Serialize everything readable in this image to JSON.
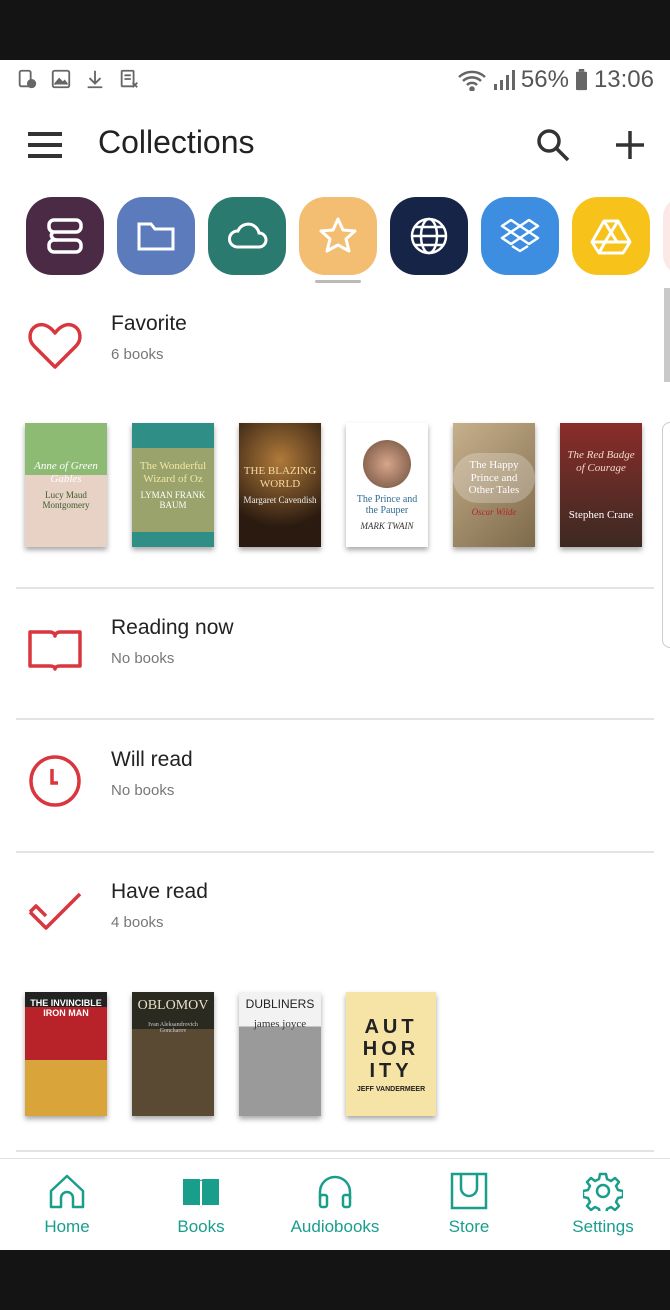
{
  "status_bar": {
    "left_icons": [
      "screenshot-icon",
      "image-icon",
      "download-icon",
      "app-notification-icon"
    ],
    "battery": "56%",
    "time": "13:06"
  },
  "app_bar": {
    "title": "Collections"
  },
  "sources": [
    {
      "icon": "stack-icon",
      "color": "#4a2a45"
    },
    {
      "icon": "folder-icon",
      "color": "#5b7bbd"
    },
    {
      "icon": "cloud-icon",
      "color": "#2b7a6f"
    },
    {
      "icon": "star-icon",
      "color": "#f3bd72"
    },
    {
      "icon": "globe-icon",
      "color": "#162447"
    },
    {
      "icon": "dropbox-icon",
      "color": "#3d8ee0"
    },
    {
      "icon": "drive-icon",
      "color": "#f7c21a"
    }
  ],
  "collections": [
    {
      "title": "Favorite",
      "count": "6 books",
      "books": [
        {
          "title": "Anne of Green Gables",
          "author": "Lucy Maud Montgomery",
          "bg": "#7fae6a"
        },
        {
          "title": "The Wonderful Wizard of Oz",
          "author": "LYMAN FRANK BAUM",
          "bg": "#2f8f86"
        },
        {
          "title": "THE BLAZING WORLD",
          "author": "Margaret Cavendish",
          "bg": "#4b2f1c"
        },
        {
          "title": "The Prince and the Pauper",
          "author": "MARK TWAIN",
          "bg": "#ffffff"
        },
        {
          "title": "The Happy Prince and Other Tales",
          "author": "Oscar Wilde",
          "bg": "#b79c7a"
        },
        {
          "title": "The Red Badge of Courage",
          "author": "Stephen Crane",
          "bg": "#5a2a22"
        }
      ]
    },
    {
      "title": "Reading now",
      "count": "No books",
      "books": []
    },
    {
      "title": "Will read",
      "count": "No books",
      "books": []
    },
    {
      "title": "Have read",
      "count": "4 books",
      "books": [
        {
          "title": "THE INVINCIBLE IRON MAN",
          "author": "",
          "bg": "#b8232a"
        },
        {
          "title": "OBLOMOV",
          "author": "Ivan Aleksandrovich Goncharov",
          "bg": "#3b3a2a"
        },
        {
          "title": "DUBLINERS",
          "author": "james joyce",
          "bg": "#d9d9d9"
        },
        {
          "title": "AUT HOR ITY",
          "author": "JEFF VANDERMEER",
          "bg": "#f6e3a6"
        }
      ]
    }
  ],
  "nav": [
    {
      "label": "Home",
      "icon": "home-icon"
    },
    {
      "label": "Books",
      "icon": "book-icon"
    },
    {
      "label": "Audiobooks",
      "icon": "headphones-icon"
    },
    {
      "label": "Store",
      "icon": "store-bag-icon"
    },
    {
      "label": "Settings",
      "icon": "gear-icon"
    }
  ],
  "colors": {
    "accent": "#1a9e8c",
    "collection_icon": "#d9363e"
  }
}
